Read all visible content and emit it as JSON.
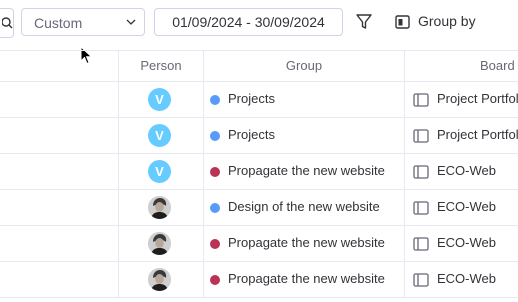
{
  "toolbar": {
    "period_select": {
      "value": "Custom"
    },
    "date_range": "01/09/2024 - 30/09/2024",
    "group_by_label": "Group by"
  },
  "table": {
    "columns": [
      "Person",
      "Group",
      "Board"
    ],
    "rows": [
      {
        "person": {
          "type": "initial",
          "initial": "V"
        },
        "group": "Projects",
        "group_color": "#579bfc",
        "board": "Project Portfolio"
      },
      {
        "person": {
          "type": "initial",
          "initial": "V"
        },
        "group": "Projects",
        "group_color": "#579bfc",
        "board": "Project Portfolio"
      },
      {
        "person": {
          "type": "initial",
          "initial": "V"
        },
        "group": "Propagate the new website",
        "group_color": "#bb3354",
        "board": "ECO-Web"
      },
      {
        "person": {
          "type": "photo"
        },
        "group": "Design of the new website",
        "group_color": "#579bfc",
        "board": "ECO-Web"
      },
      {
        "person": {
          "type": "photo"
        },
        "group": "Propagate the new website",
        "group_color": "#bb3354",
        "board": "ECO-Web"
      },
      {
        "person": {
          "type": "photo"
        },
        "group": "Propagate the new website",
        "group_color": "#bb3354",
        "board": "ECO-Web"
      }
    ]
  },
  "colors": {
    "accent_blue": "#579bfc",
    "accent_red": "#bb3354",
    "avatar_blue": "#66ccff"
  },
  "icons": [
    "search-icon",
    "chevron-down-icon",
    "filter-icon",
    "group-by-icon",
    "board-icon",
    "mouse-cursor-icon"
  ]
}
